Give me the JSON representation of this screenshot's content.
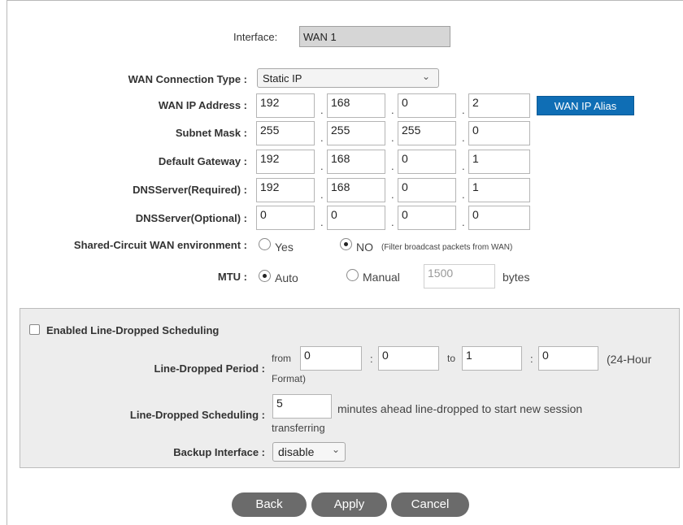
{
  "interface": {
    "label": "Interface:",
    "value": "WAN 1"
  },
  "wan": {
    "connection_type_label": "WAN  Connection Type :",
    "connection_type_value": "Static IP",
    "ip_label": "WAN  IP Address :",
    "ip": [
      "192",
      "168",
      "0",
      "2"
    ],
    "ip_alias_button": "WAN IP Alias",
    "subnet_label": "Subnet Mask :",
    "subnet": [
      "255",
      "255",
      "255",
      "0"
    ],
    "gateway_label": "Default Gateway :",
    "gateway": [
      "192",
      "168",
      "0",
      "1"
    ],
    "dns_req_label": "DNSServer(Required) :",
    "dns_req": [
      "192",
      "168",
      "0",
      "1"
    ],
    "dns_opt_label": "DNSServer(Optional) :",
    "dns_opt": [
      "0",
      "0",
      "0",
      "0"
    ],
    "shared_label": "Shared-Circuit WAN environment :",
    "shared_yes": "Yes",
    "shared_no": "NO",
    "shared_note": "(Filter broadcast packets from WAN)",
    "mtu_label": "MTU :",
    "mtu_auto": "Auto",
    "mtu_manual": "Manual",
    "mtu_value": "1500",
    "mtu_unit": "bytes"
  },
  "schedule": {
    "enable_label": "Enabled Line-Dropped Scheduling",
    "period_label": "Line-Dropped Period :",
    "from_text": "from",
    "from_h": "0",
    "from_m": "0",
    "to_text": "to",
    "to_h": "1",
    "to_m": "0",
    "colon": ":",
    "format_a": "(24-Hour",
    "format_b": "Format)",
    "sched_label": "Line-Dropped Scheduling :",
    "minutes_value": "5",
    "minutes_text_a": "minutes ahead line-dropped to start new session",
    "minutes_text_b": "transferring",
    "backup_label": "Backup Interface :",
    "backup_value": "disable"
  },
  "buttons": {
    "back": "Back",
    "apply": "Apply",
    "cancel": "Cancel"
  },
  "colors": {
    "accent": "#0f6eb5",
    "panel": "#ededed",
    "button": "#6b6b6b"
  }
}
